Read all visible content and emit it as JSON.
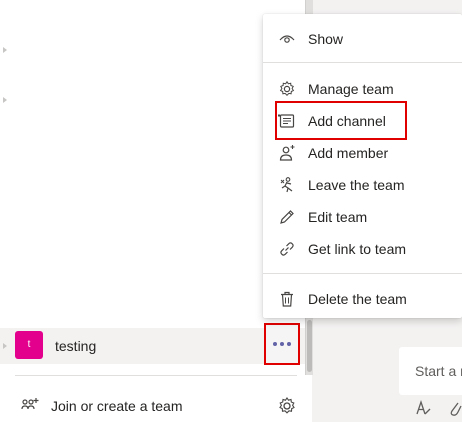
{
  "menu": {
    "items": [
      {
        "label": "Show",
        "icon": "eye-icon"
      },
      {
        "label": "Manage team",
        "icon": "gear-icon"
      },
      {
        "label": "Add channel",
        "icon": "add-channel-icon"
      },
      {
        "label": "Add member",
        "icon": "add-member-icon"
      },
      {
        "label": "Leave the team",
        "icon": "leave-team-icon"
      },
      {
        "label": "Edit team",
        "icon": "pencil-icon"
      },
      {
        "label": "Get link to team",
        "icon": "link-icon"
      },
      {
        "label": "Delete the team",
        "icon": "trash-icon"
      }
    ]
  },
  "team": {
    "avatar_letter": "t",
    "name": "testing",
    "avatar_color": "#e3008c"
  },
  "footer": {
    "join_label": "Join or create a team"
  },
  "compose": {
    "placeholder": "Start a n"
  },
  "colors": {
    "accent": "#6264a7",
    "highlight": "#e00000"
  }
}
